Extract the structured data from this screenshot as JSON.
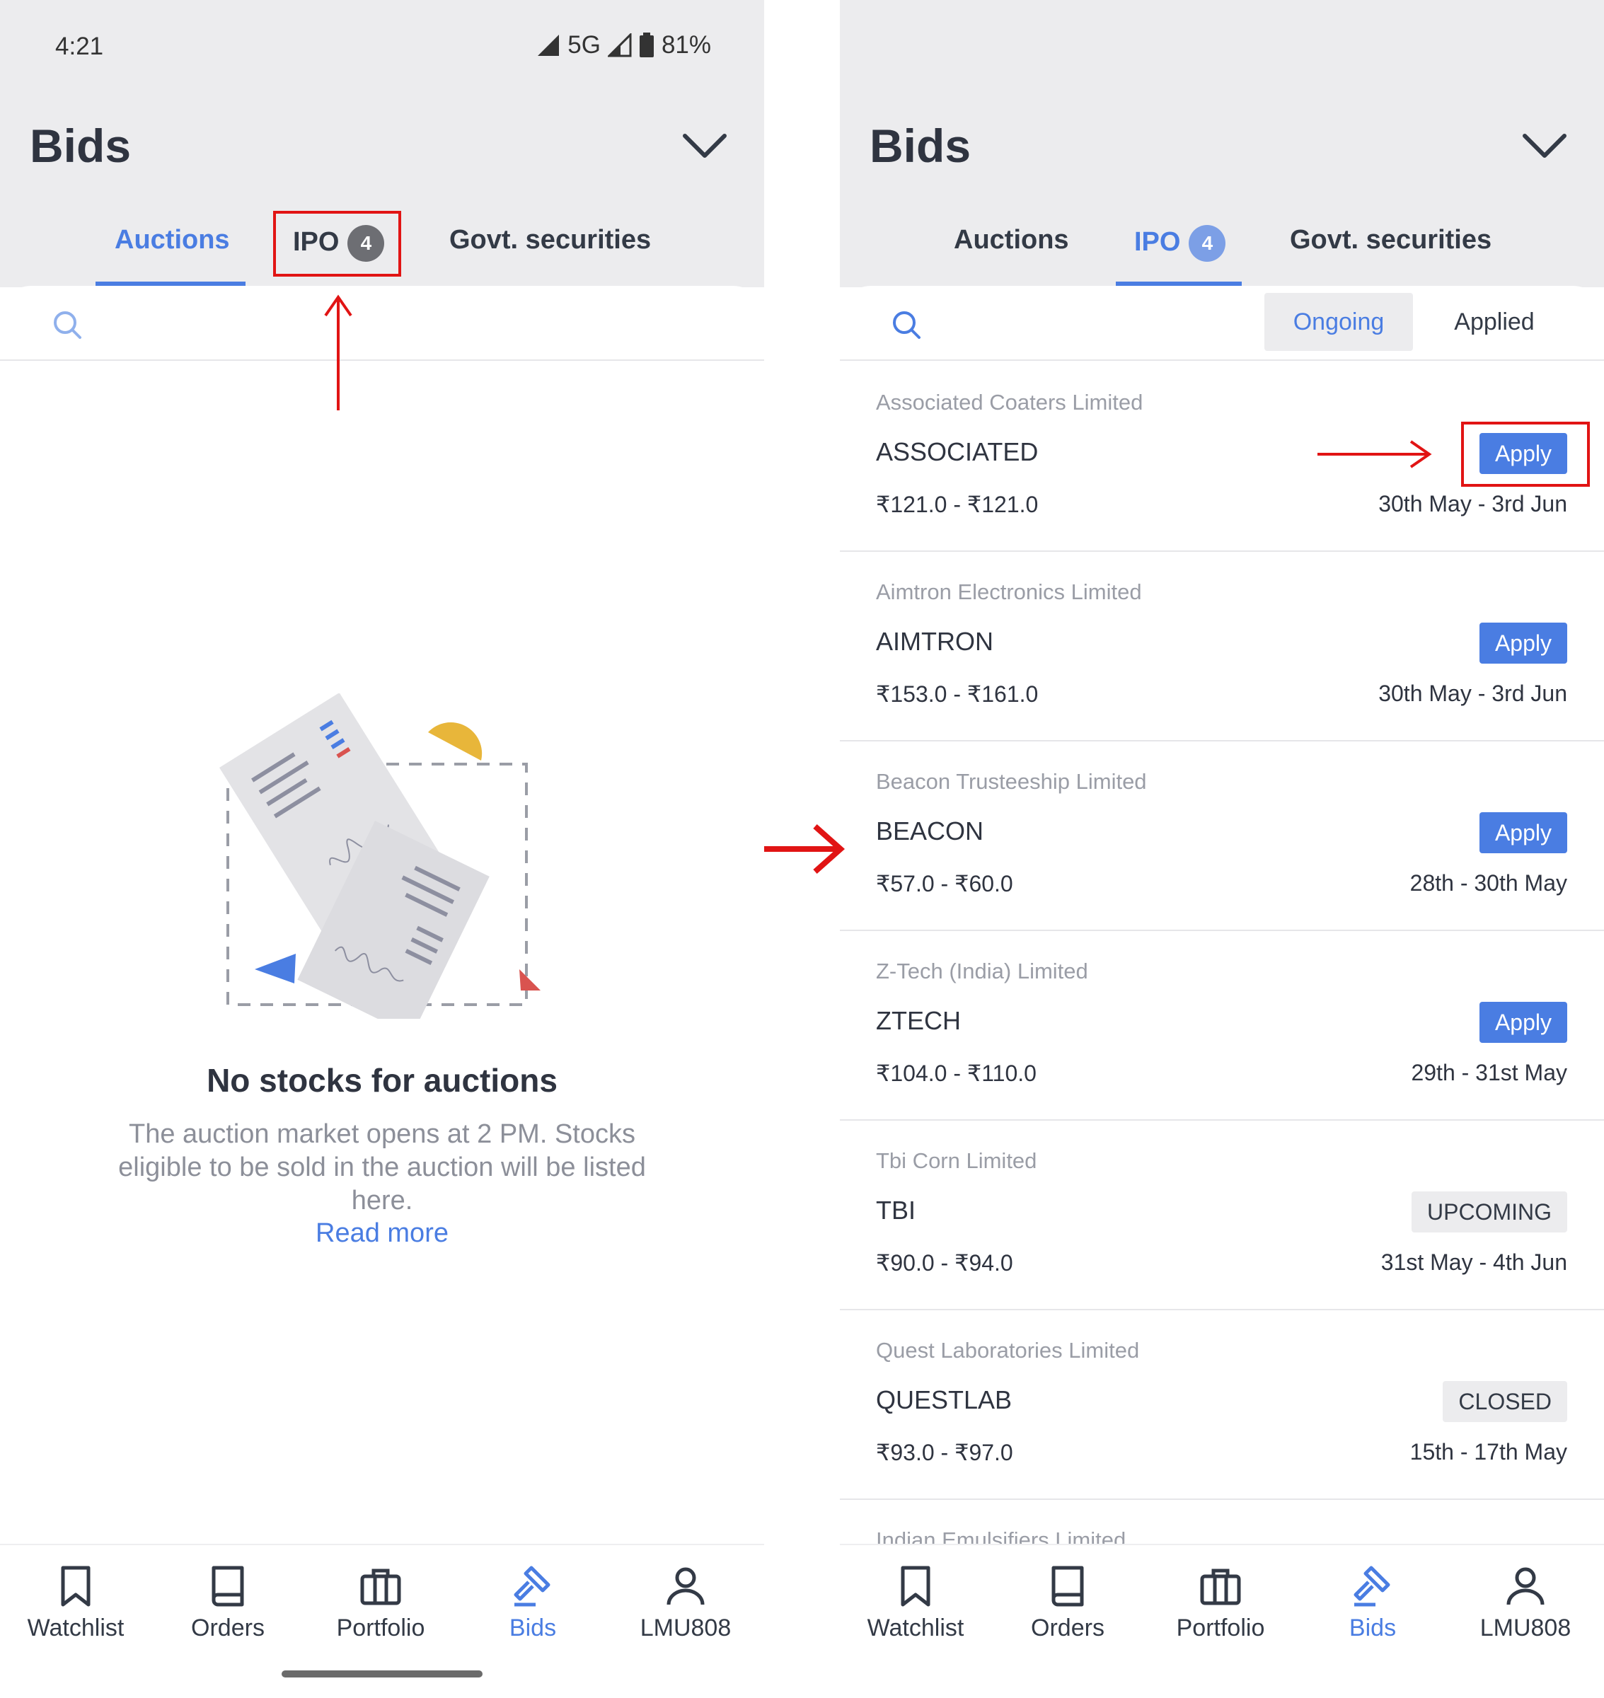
{
  "status_bar": {
    "time": "4:21",
    "network": "5G",
    "battery": "81%"
  },
  "header": {
    "title": "Bids"
  },
  "tabs": {
    "auctions": "Auctions",
    "ipo": "IPO",
    "ipo_count": "4",
    "govt": "Govt. securities"
  },
  "left_screen": {
    "empty_title": "No stocks for auctions",
    "empty_description": "The auction market opens at 2 PM. Stocks eligible to be sold in the auction will be listed here.",
    "read_more": "Read more"
  },
  "right_screen": {
    "filters": {
      "ongoing": "Ongoing",
      "applied": "Applied"
    },
    "ipos": [
      {
        "company": "Associated Coaters Limited",
        "symbol": "ASSOCIATED",
        "price": "₹121.0 - ₹121.0",
        "dates": "30th May - 3rd Jun",
        "action": "Apply"
      },
      {
        "company": "Aimtron Electronics Limited",
        "symbol": "AIMTRON",
        "price": "₹153.0 - ₹161.0",
        "dates": "30th May - 3rd Jun",
        "action": "Apply"
      },
      {
        "company": "Beacon Trusteeship Limited",
        "symbol": "BEACON",
        "price": "₹57.0 - ₹60.0",
        "dates": "28th - 30th May",
        "action": "Apply"
      },
      {
        "company": "Z-Tech (India) Limited",
        "symbol": "ZTECH",
        "price": "₹104.0 - ₹110.0",
        "dates": "29th - 31st May",
        "action": "Apply"
      },
      {
        "company": "Tbi Corn Limited",
        "symbol": "TBI",
        "price": "₹90.0 - ₹94.0",
        "dates": "31st May - 4th Jun",
        "status": "UPCOMING"
      },
      {
        "company": "Quest Laboratories Limited",
        "symbol": "QUESTLAB",
        "price": "₹93.0 - ₹97.0",
        "dates": "15th - 17th May",
        "status": "CLOSED"
      },
      {
        "company": "Indian Emulsifiers Limited"
      }
    ]
  },
  "bottom_nav": {
    "watchlist": "Watchlist",
    "orders": "Orders",
    "portfolio": "Portfolio",
    "bids": "Bids",
    "profile": "LMU808"
  },
  "colors": {
    "accent": "#4a7de2",
    "header_bg": "#ececee",
    "annotation": "#e11414"
  }
}
